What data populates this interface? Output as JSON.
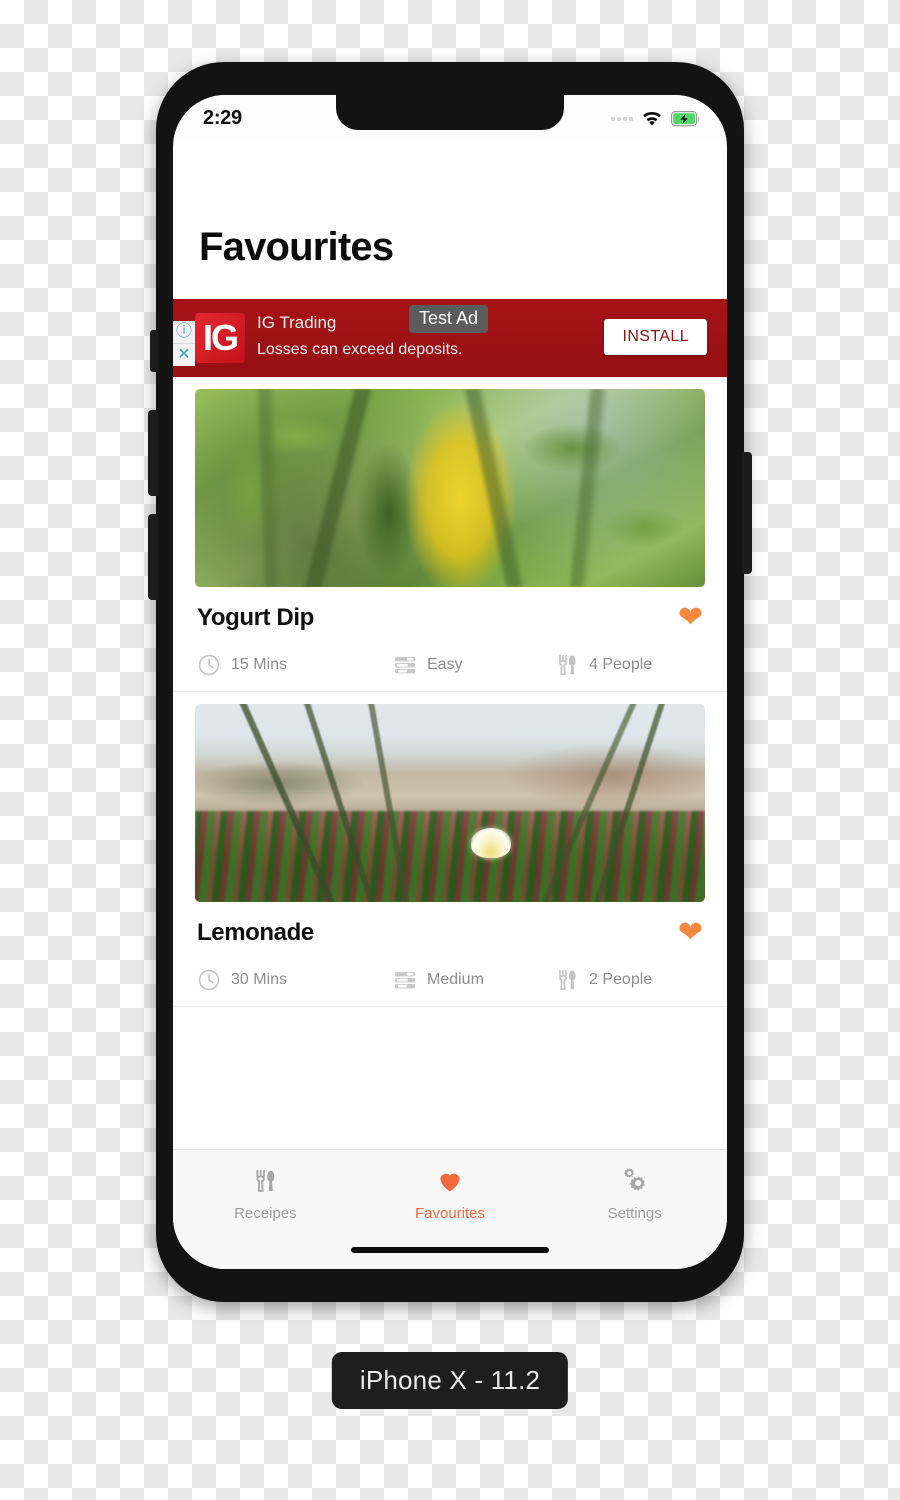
{
  "device": {
    "label": "iPhone X - 11.2"
  },
  "status_bar": {
    "time": "2:29",
    "signal_icon": "signal-dots-icon",
    "wifi_icon": "wifi-icon",
    "battery_icon": "battery-charging-icon",
    "battery_color": "#4cd964"
  },
  "header": {
    "title": "Favourites"
  },
  "ad": {
    "logo_text": "IG",
    "headline": "IG Trading",
    "body": "Losses can exceed deposits.",
    "test_label": "Test Ad",
    "install_label": "INSTALL",
    "info_icon": "info-icon",
    "close_icon": "close-icon",
    "background_color": "#9e1115",
    "install_text_color": "#8e0f13"
  },
  "recipes": [
    {
      "title": "Yogurt Dip",
      "photo": "leaves-photo",
      "favourite": true,
      "favourite_icon": "heart-filled-icon",
      "time": "15 Mins",
      "difficulty": "Easy",
      "servings": "4 People",
      "time_icon": "clock-icon",
      "difficulty_icon": "tune-sliders-icon",
      "servings_icon": "fork-knife-icon"
    },
    {
      "title": "Lemonade",
      "photo": "dune-flower-photo",
      "favourite": true,
      "favourite_icon": "heart-filled-icon",
      "time": "30 Mins",
      "difficulty": "Medium",
      "servings": "2 People",
      "time_icon": "clock-icon",
      "difficulty_icon": "tune-sliders-icon",
      "servings_icon": "fork-knife-icon"
    }
  ],
  "tabs": [
    {
      "label": "Receipes",
      "icon": "fork-knife-icon",
      "active": false
    },
    {
      "label": "Favourites",
      "icon": "heart-filled-icon",
      "active": true
    },
    {
      "label": "Settings",
      "icon": "gears-icon",
      "active": false
    }
  ],
  "theme": {
    "accent": "#f4693c",
    "heart": "#f5873f",
    "muted_text": "#8d8d8d"
  }
}
